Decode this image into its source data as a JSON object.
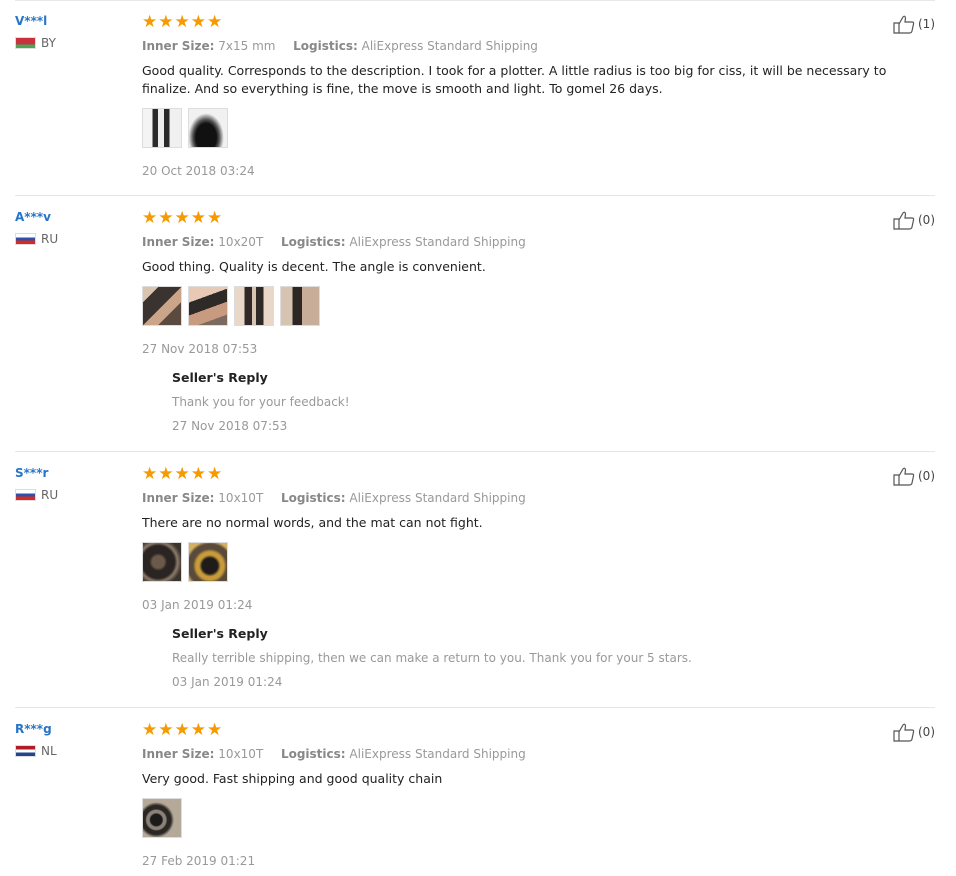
{
  "colors": {
    "star": "#f59a00",
    "username": "#2775c7",
    "muted": "#999999"
  },
  "labels": {
    "inner_size": "Inner Size:",
    "logistics": "Logistics:",
    "seller_reply": "Seller's Reply"
  },
  "reviews": [
    {
      "user": "V***l",
      "country": "BY",
      "stars": 5,
      "inner_size": "7x15 mm",
      "logistics": "AliExpress Standard Shipping",
      "text": "Good quality. Corresponds to the description. I took for a plotter. A little radius is too big for ciss, it will be necessary to finalize. And so everything is fine, the move is smooth and light. To gomel 26 days.",
      "photo_count": 2,
      "date": "20 Oct 2018 03:24",
      "likes": "(1)"
    },
    {
      "user": "A***v",
      "country": "RU",
      "stars": 5,
      "inner_size": "10x20T",
      "logistics": "AliExpress Standard Shipping",
      "text": "Good thing. Quality is decent. The angle is convenient.",
      "photo_count": 4,
      "date": "27 Nov 2018 07:53",
      "likes": "(0)",
      "reply": {
        "message": "Thank you for your feedback!",
        "date": "27 Nov 2018 07:53"
      }
    },
    {
      "user": "S***r",
      "country": "RU",
      "stars": 5,
      "inner_size": "10x10T",
      "logistics": "AliExpress Standard Shipping",
      "text": "There are no normal words, and the mat can not fight.",
      "photo_count": 2,
      "date": "03 Jan 2019 01:24",
      "likes": "(0)",
      "reply": {
        "message": "Really terrible shipping, then we can make a return to you. Thank you for your 5 stars.",
        "date": "03 Jan 2019 01:24"
      }
    },
    {
      "user": "R***g",
      "country": "NL",
      "stars": 5,
      "inner_size": "10x10T",
      "logistics": "AliExpress Standard Shipping",
      "text": "Very good. Fast shipping and good quality chain",
      "photo_count": 1,
      "date": "27 Feb 2019 01:21",
      "likes": "(0)"
    }
  ]
}
